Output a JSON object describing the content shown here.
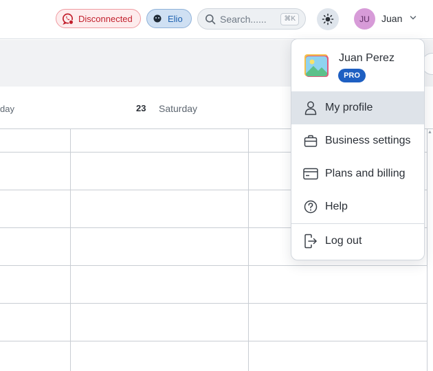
{
  "header": {
    "connection_status": "Disconnected",
    "assistant_label": "Elio",
    "search_placeholder": "Search......",
    "search_shortcut": "⌘K",
    "user_initials": "JU",
    "user_short_name": "Juan"
  },
  "calendar": {
    "prev_day_partial": "day",
    "day_number": "23",
    "day_name": "Saturday"
  },
  "user_menu": {
    "full_name": "Juan Perez",
    "plan_badge": "PRO",
    "items": [
      {
        "label": "My profile",
        "icon": "user-icon",
        "active": true
      },
      {
        "label": "Business settings",
        "icon": "briefcase-icon",
        "active": false
      },
      {
        "label": "Plans and billing",
        "icon": "credit-card-icon",
        "active": false
      },
      {
        "label": "Help",
        "icon": "help-icon",
        "active": false
      }
    ],
    "logout_label": "Log out"
  },
  "colors": {
    "disconnected": "#c21f2c",
    "assistant": "#1b5fae",
    "pro_badge": "#1e5fc2",
    "avatar": "#d79bd8",
    "active_item": "#dee3e9"
  }
}
